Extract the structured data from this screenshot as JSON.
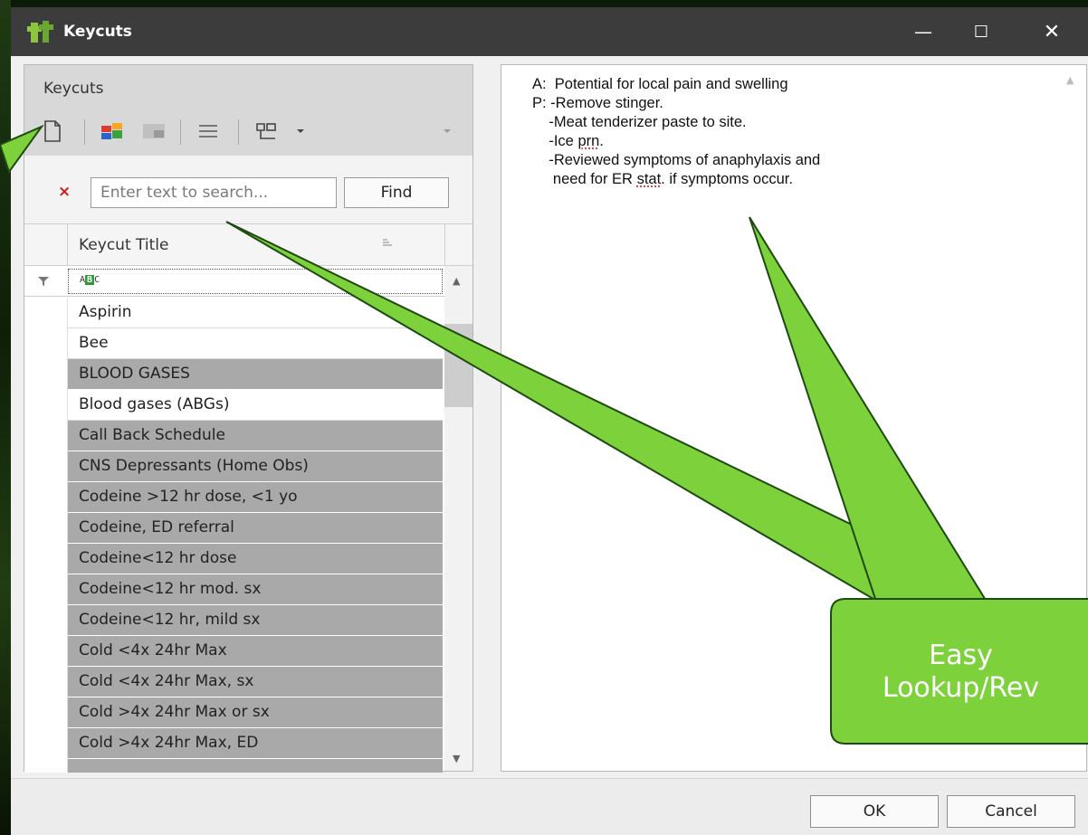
{
  "window": {
    "title": "Keycuts",
    "controls": {
      "minimize": "—",
      "maximize": "☐",
      "close": "✕"
    }
  },
  "ribbon": {
    "title": "Keycuts",
    "tools": [
      "new-document-icon",
      "color-categories-icon",
      "layout-icon",
      "list-icon",
      "view-options-icon",
      "chevron-down-icon",
      "chevron-down-icon"
    ]
  },
  "search": {
    "clear": "×",
    "placeholder": "Enter text to search...",
    "find_label": "Find"
  },
  "grid": {
    "column_title": "Keycut Title",
    "filter_badge_left": "A",
    "filter_badge_mid": "B",
    "filter_badge_right": "C",
    "rows": [
      "Aspirin",
      "Bee",
      "BLOOD GASES",
      "Blood gases (ABGs)",
      "Call Back Schedule",
      "CNS Depressants (Home Obs)",
      "Codeine >12 hr dose, <1 yo",
      "Codeine, ED referral",
      "Codeine<12 hr dose",
      "Codeine<12 hr mod. sx",
      "Codeine<12 hr, mild sx",
      "Cold <4x 24hr Max",
      "Cold <4x 24hr Max, sx",
      "Cold >4x 24hr Max or sx",
      "Cold >4x 24hr Max, ED"
    ],
    "selected_index": 1
  },
  "note": {
    "line1": "A:  Potential for local pain and swelling",
    "line2": "P: -Remove stinger.",
    "line3": "    -Meat tenderizer paste to site.",
    "line4a": "    -Ice ",
    "line4b": "prn",
    "line4c": ".",
    "line5": "    -Reviewed symptoms of anaphylaxis and",
    "line6a": "     need for ER ",
    "line6b": "stat",
    "line6c": ". if symptoms occur."
  },
  "buttons": {
    "ok": "OK",
    "cancel": "Cancel"
  },
  "callout": {
    "line1": "Easy",
    "line2": "Lookup/Rev",
    "color": "#7dd13a",
    "outline": "#1e4a12"
  }
}
